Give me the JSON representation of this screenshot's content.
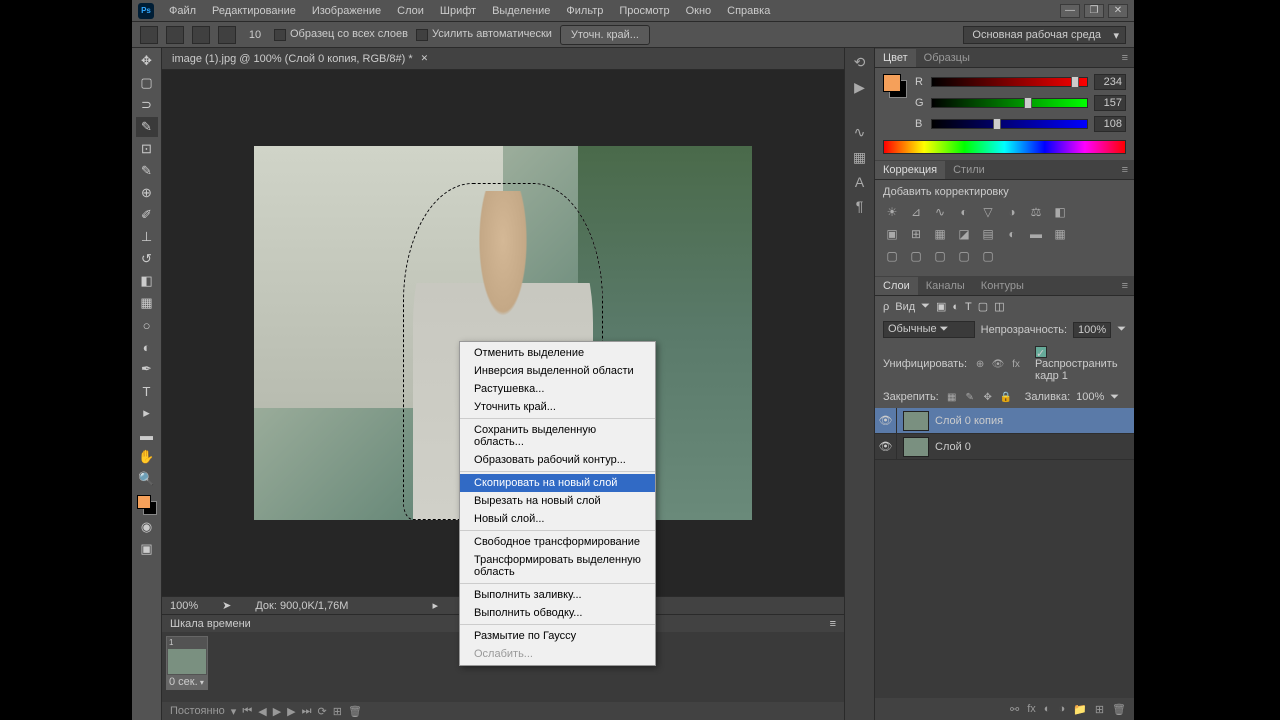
{
  "app": {
    "logo": "Ps"
  },
  "menu": [
    "Файл",
    "Редактирование",
    "Изображение",
    "Слои",
    "Шрифт",
    "Выделение",
    "Фильтр",
    "Просмотр",
    "Окно",
    "Справка"
  ],
  "options": {
    "brush_size": "10",
    "sample_all": "Образец со всех слоев",
    "auto_enhance": "Усилить автоматически",
    "refine": "Уточн. край...",
    "workspace": "Основная рабочая среда"
  },
  "doc_tab": "image (1).jpg @ 100% (Слой 0 копия, RGB/8#) *",
  "status": {
    "zoom": "100%",
    "doc": "Док: 900,0K/1,76M"
  },
  "timeline": {
    "title": "Шкала времени",
    "frame": "1",
    "time": "0 сек.",
    "loop": "Постоянно"
  },
  "color": {
    "tab1": "Цвет",
    "tab2": "Образцы",
    "r_label": "R",
    "g_label": "G",
    "b_label": "B",
    "r": "234",
    "g": "157",
    "b": "108"
  },
  "adjust": {
    "tab1": "Коррекция",
    "tab2": "Стили",
    "title": "Добавить корректировку"
  },
  "layers": {
    "tab1": "Слои",
    "tab2": "Каналы",
    "tab3": "Контуры",
    "kind": "Вид",
    "blend": "Обычные",
    "opacity_label": "Непрозрачность:",
    "opacity": "100%",
    "unify": "Унифицировать:",
    "propagate": "Распространить кадр 1",
    "lock": "Закрепить:",
    "fill_label": "Заливка:",
    "fill": "100%",
    "layer1": "Слой 0 копия",
    "layer2": "Слой 0"
  },
  "context": {
    "deselect": "Отменить выделение",
    "inverse": "Инверсия выделенной области",
    "feather": "Растушевка...",
    "refine": "Уточнить край...",
    "save_sel": "Сохранить выделенную область...",
    "make_path": "Образовать рабочий контур...",
    "copy_layer": "Скопировать на новый слой",
    "cut_layer": "Вырезать на новый слой",
    "new_layer": "Новый слой...",
    "free_trans": "Свободное трансформирование",
    "trans_sel": "Трансформировать выделенную область",
    "fill": "Выполнить заливку...",
    "stroke": "Выполнить обводку...",
    "gauss": "Размытие по Гауссу",
    "fade": "Ослабить..."
  }
}
